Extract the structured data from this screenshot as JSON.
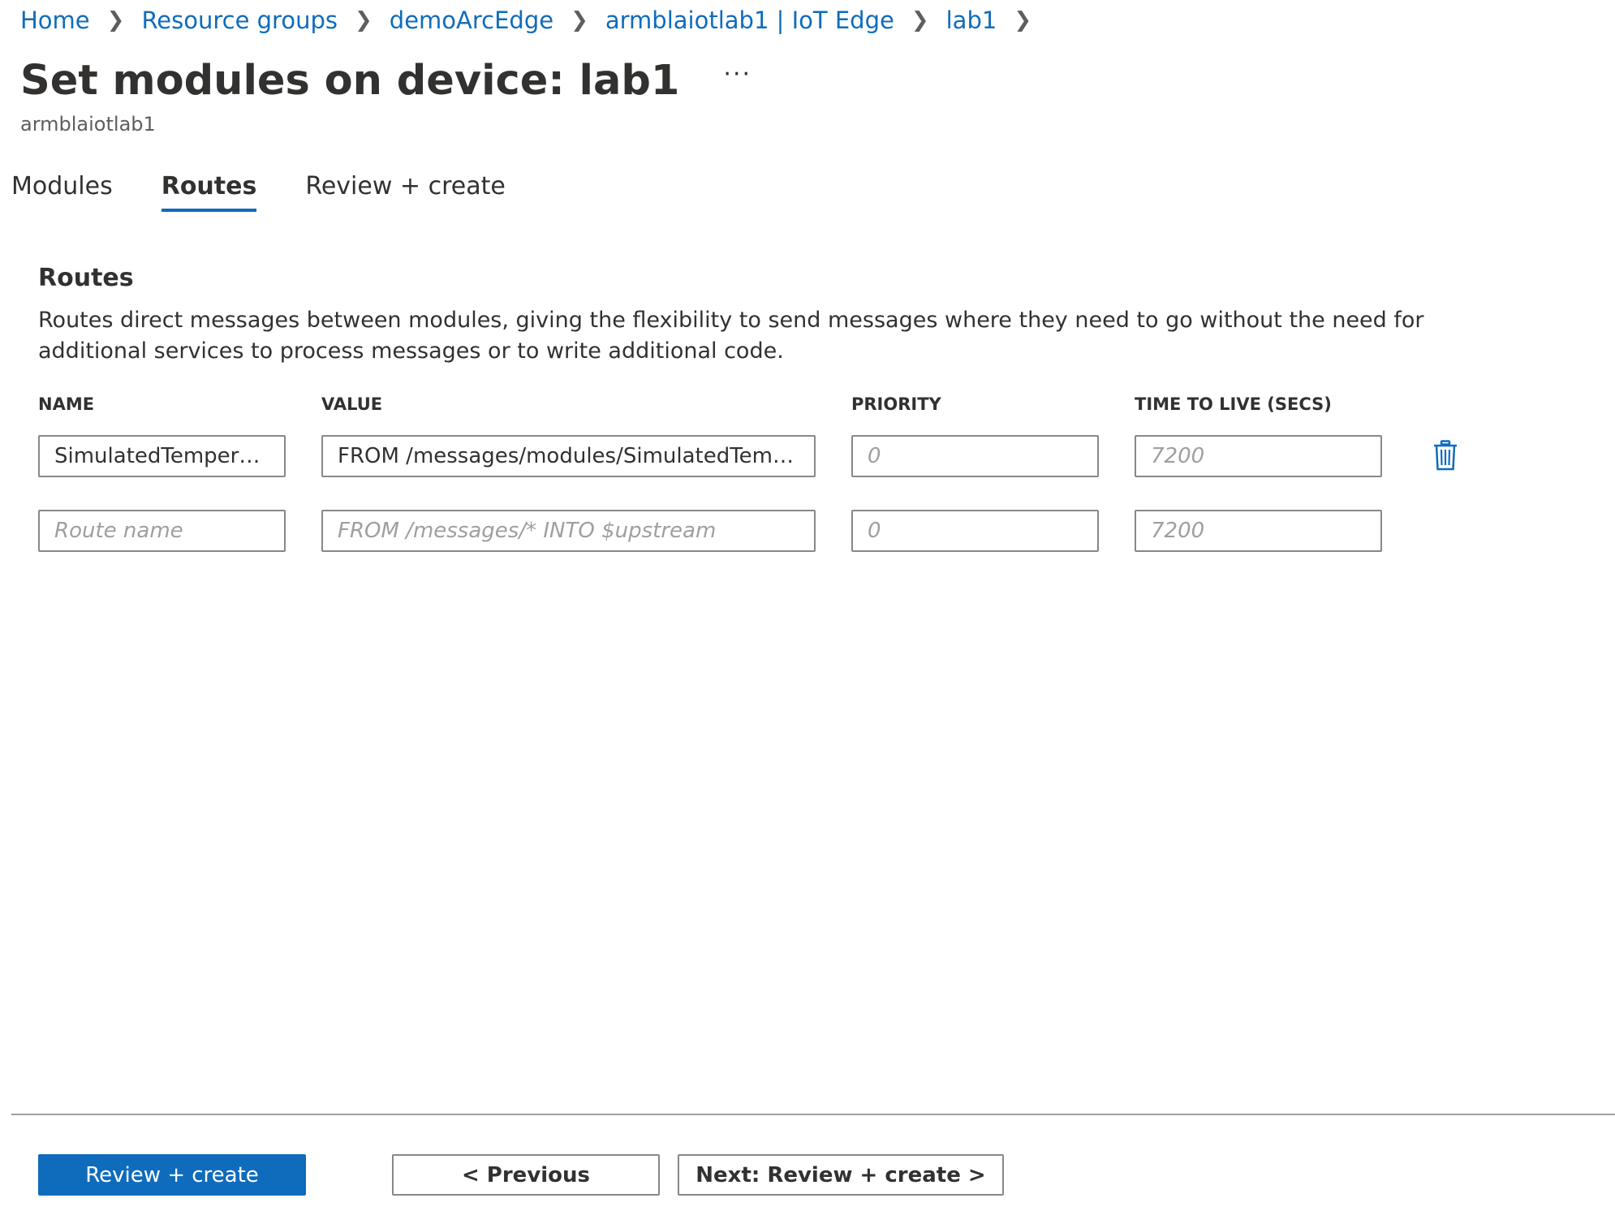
{
  "breadcrumb": {
    "items": [
      {
        "label": "Home"
      },
      {
        "label": "Resource groups"
      },
      {
        "label": "demoArcEdge"
      },
      {
        "label": "armblaiotlab1 | IoT Edge"
      },
      {
        "label": "lab1"
      }
    ]
  },
  "header": {
    "title": "Set modules on device: lab1",
    "more_label": "···",
    "subtitle": "armblaiotlab1"
  },
  "tabs": [
    {
      "label": "Modules",
      "active": false
    },
    {
      "label": "Routes",
      "active": true
    },
    {
      "label": "Review + create",
      "active": false
    }
  ],
  "routes_section": {
    "title": "Routes",
    "description": "Routes direct messages between modules, giving the flexibility to send messages where they need to go without the need for additional services to process messages or to write additional code.",
    "columns": {
      "name": "NAME",
      "value": "VALUE",
      "priority": "PRIORITY",
      "ttl": "TIME TO LIVE (SECS)"
    },
    "rows": [
      {
        "name": "SimulatedTemperat...",
        "value": "FROM /messages/modules/SimulatedTemp...",
        "priority_placeholder": "0",
        "ttl_placeholder": "7200",
        "delete_icon": "trash-icon"
      },
      {
        "name_placeholder": "Route name",
        "value_placeholder": "FROM /messages/* INTO $upstream",
        "priority_placeholder": "0",
        "ttl_placeholder": "7200"
      }
    ]
  },
  "footer": {
    "review_create_label": "Review + create",
    "previous_label": "< Previous",
    "next_label": "Next: Review + create >"
  },
  "colors": {
    "accent": "#0f6cbd",
    "text": "#323130",
    "border": "#8a8886",
    "placeholder": "#a19f9d"
  }
}
